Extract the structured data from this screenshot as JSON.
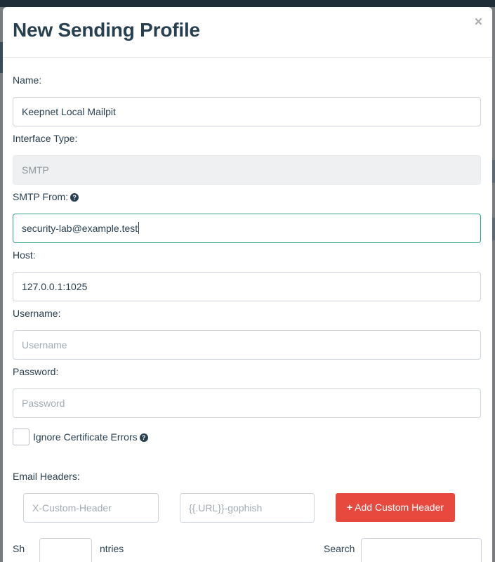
{
  "modal": {
    "title": "New Sending Profile",
    "close_glyph": "×"
  },
  "form": {
    "name": {
      "label": "Name:",
      "value": "Keepnet Local Mailpit"
    },
    "interface_type": {
      "label": "Interface Type:",
      "value": "SMTP"
    },
    "smtp_from": {
      "label": "SMTP From:",
      "value": "security-lab@example.test"
    },
    "host": {
      "label": "Host:",
      "value": "127.0.0.1:1025"
    },
    "username": {
      "label": "Username:",
      "placeholder": "Username"
    },
    "password": {
      "label": "Password:",
      "placeholder": "Password"
    },
    "ignore_cert": {
      "label": "Ignore Certificate Errors",
      "checked": false
    }
  },
  "headers": {
    "label": "Email Headers:",
    "header_placeholder": "X-Custom-Header",
    "value_placeholder": "{{.URL}}-gophish",
    "add_button": "Add Custom Header"
  },
  "table_controls": {
    "show_label_partial": "Sh",
    "entries_partial": "ntries",
    "search_partial": "Search"
  },
  "icons": {
    "help": "question-circle-icon",
    "close": "close-icon",
    "plus": "plus-icon"
  },
  "colors": {
    "add_button": "#e8493f",
    "focus_border": "#37a08c",
    "title": "#283f50"
  }
}
